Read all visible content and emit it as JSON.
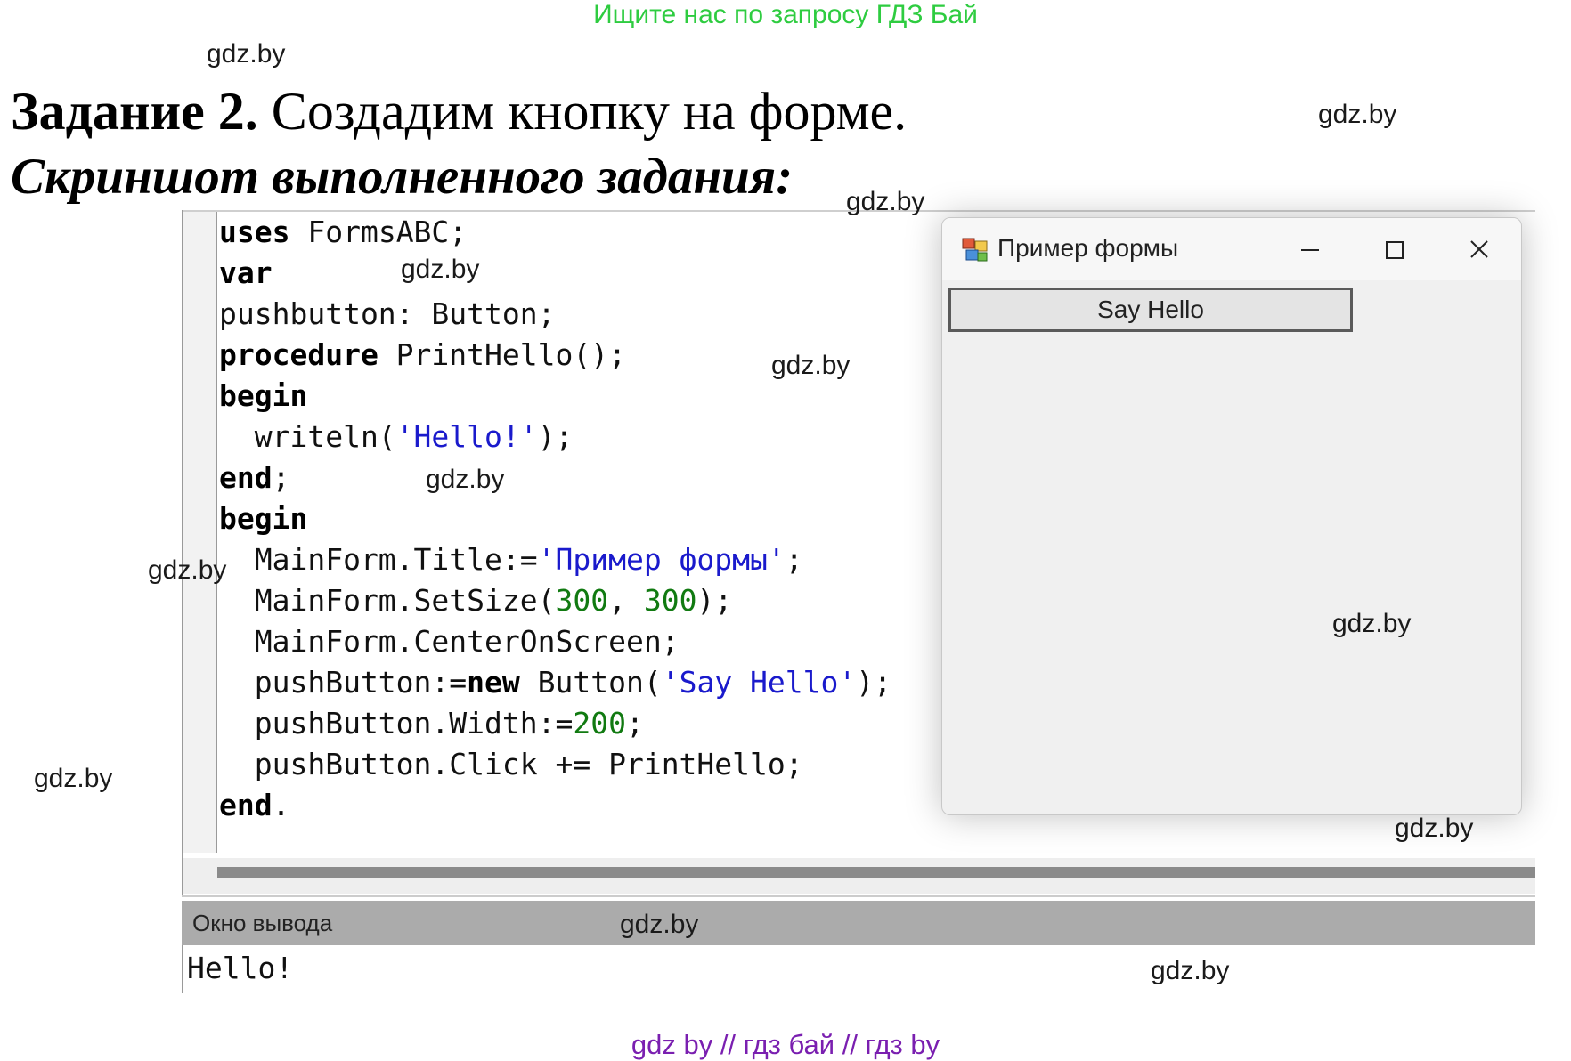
{
  "banner": "Ищите нас по запросу ГДЗ Бай",
  "watermark": "gdz.by",
  "heading": {
    "bold": "Задание 2.",
    "rest": " Создадим кнопку на форме."
  },
  "subheading": "Скриншот выполненного задания:",
  "code": {
    "l1a": "uses",
    "l1b": " FormsABC;",
    "l2": "var",
    "l3": "pushbutton: Button;",
    "l4a": "procedure",
    "l4b": " PrintHello();",
    "l5": "begin",
    "l6a": "  writeln(",
    "l6b": "'Hello!'",
    "l6c": ");",
    "l7a": "end",
    "l7b": ";",
    "l8": "begin",
    "l9a": "  MainForm.Title:=",
    "l9b": "'Пример формы'",
    "l9c": ";",
    "l10a": "  MainForm.SetSize(",
    "l10b": "300",
    "l10c": ", ",
    "l10d": "300",
    "l10e": ");",
    "l11": "  MainForm.CenterOnScreen;",
    "l12a": "  pushButton:=",
    "l12b": "new",
    "l12c": " Button(",
    "l12d": "'Say Hello'",
    "l12e": ");",
    "l13a": "  pushButton.Width:=",
    "l13b": "200",
    "l13c": ";",
    "l14": "  pushButton.Click += PrintHello;",
    "l15a": "end",
    "l15b": "."
  },
  "output": {
    "title": "Окно вывода",
    "text": "Hello!"
  },
  "form": {
    "title": "Пример формы",
    "button_label": "Say Hello"
  },
  "footer": "gdz by  //  гдз бай  //  гдз by",
  "colors": {
    "banner": "#2ecc40",
    "footer": "#7a1fb0",
    "string": "#1a1acc",
    "number": "#117a11"
  }
}
